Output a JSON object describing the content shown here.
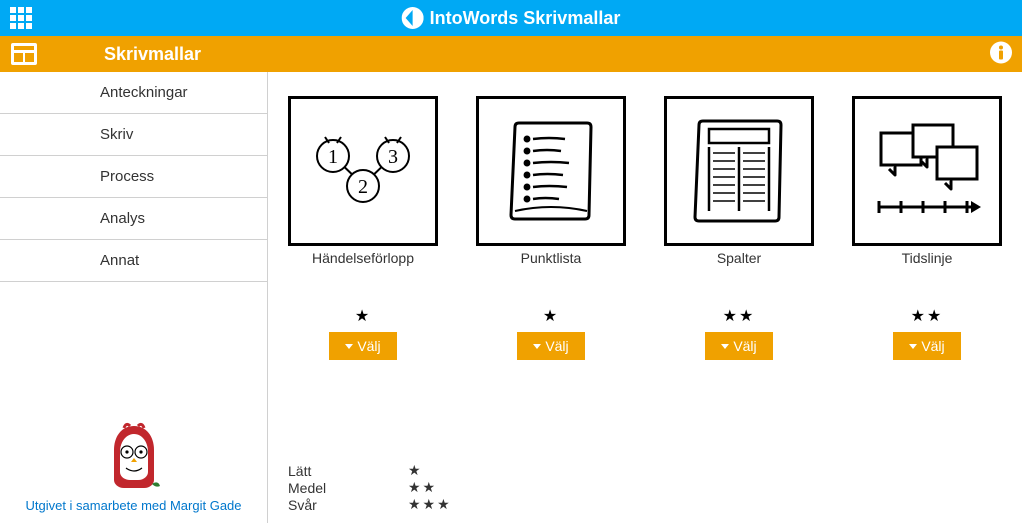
{
  "topbar": {
    "title": "IntoWords Skrivmallar"
  },
  "subbar": {
    "title": "Skrivmallar"
  },
  "sidebar": {
    "items": [
      {
        "label": "Anteckningar",
        "selected": true
      },
      {
        "label": "Skriv",
        "selected": false
      },
      {
        "label": "Process",
        "selected": false
      },
      {
        "label": "Analys",
        "selected": false
      },
      {
        "label": "Annat",
        "selected": false
      }
    ]
  },
  "publisher": {
    "text": "Utgivet i samarbete med Margit Gade"
  },
  "templates": [
    {
      "title": "Händelseförlopp",
      "stars": "★",
      "button": "Välj",
      "icon": "sequence"
    },
    {
      "title": "Punktlista",
      "stars": "★",
      "button": "Välj",
      "icon": "bulletlist"
    },
    {
      "title": "Spalter",
      "stars": "★★",
      "button": "Välj",
      "icon": "columns"
    },
    {
      "title": "Tidslinje",
      "stars": "★★",
      "button": "Välj",
      "icon": "timeline"
    }
  ],
  "legend": [
    {
      "label": "Lätt",
      "stars": "★"
    },
    {
      "label": "Medel",
      "stars": "★★"
    },
    {
      "label": "Svår",
      "stars": "★★★"
    }
  ]
}
